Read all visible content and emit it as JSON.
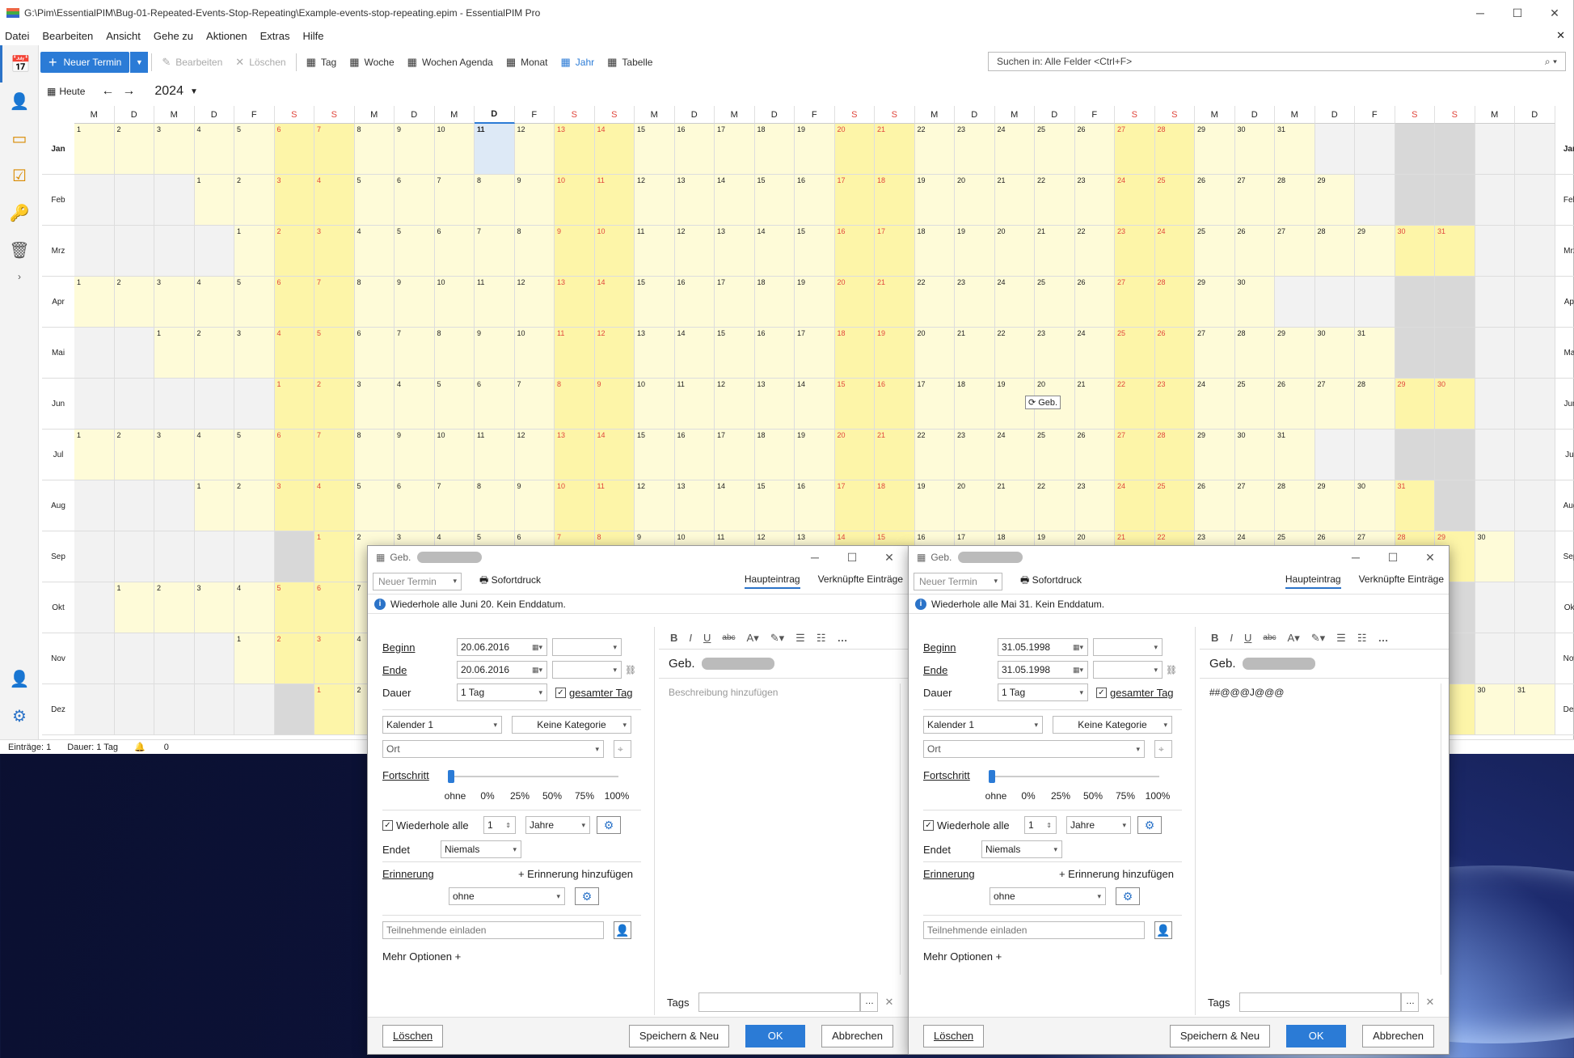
{
  "window": {
    "title": "G:\\Pim\\EssentialPIM\\Bug-01-Repeated-Events-Stop-Repeating\\Example-events-stop-repeating.epim - EssentialPIM Pro"
  },
  "menu": [
    "Datei",
    "Bearbeiten",
    "Ansicht",
    "Gehe zu",
    "Aktionen",
    "Extras",
    "Hilfe"
  ],
  "toolbar": {
    "new_appointment": "Neuer Termin",
    "edit": "Bearbeiten",
    "delete": "Löschen",
    "views": [
      "Tag",
      "Woche",
      "Wochen Agenda",
      "Monat",
      "Jahr",
      "Tabelle"
    ],
    "active_view": "Jahr",
    "search_placeholder": "Suchen in: Alle Felder  <Ctrl+F>"
  },
  "nav": {
    "today": "Heute",
    "year": "2024"
  },
  "calendar": {
    "weekday_header": [
      "M",
      "D",
      "M",
      "D",
      "F",
      "S",
      "S",
      "M",
      "D",
      "M",
      "D",
      "F",
      "S",
      "S",
      "M",
      "D",
      "M",
      "D",
      "F",
      "S",
      "S",
      "M",
      "D",
      "M",
      "D",
      "F",
      "S",
      "S",
      "M",
      "D",
      "M",
      "D",
      "F",
      "S",
      "S",
      "M",
      "D"
    ],
    "months": [
      "Jan",
      "Feb",
      "Mrz",
      "Apr",
      "Mai",
      "Jun",
      "Jul",
      "Aug",
      "Sep",
      "Okt",
      "Nov",
      "Dez"
    ],
    "month_offsets": [
      0,
      3,
      4,
      0,
      2,
      5,
      0,
      3,
      6,
      1,
      4,
      6
    ],
    "month_lengths": [
      31,
      29,
      31,
      30,
      31,
      30,
      31,
      31,
      30,
      31,
      30,
      31
    ],
    "today_column": 10,
    "event": {
      "label": "Geb.",
      "icon": "repeat-icon",
      "date": "2024-06-20"
    }
  },
  "statusbar": {
    "entries": "Einträge: 1",
    "duration": "Dauer: 1 Tag",
    "reminders": "0"
  },
  "dialogs": [
    {
      "title": "Geb.",
      "type": "Neuer Termin",
      "print": "Sofortdruck",
      "tabs": [
        "Haupteintrag",
        "Verknüpfte Einträge"
      ],
      "info": "Wiederhole alle Juni 20. Kein Enddatum.",
      "labels": {
        "begin": "Beginn",
        "end": "Ende",
        "duration": "Dauer",
        "allday": "gesamter Tag",
        "progress": "Fortschritt",
        "repeat": "Wiederhole alle",
        "ends": "Endet",
        "reminder": "Erinnerung",
        "add_reminder": "+ Erinnerung hinzufügen",
        "invite": "Teilnehmende einladen",
        "more": "Mehr Optionen +",
        "tags": "Tags"
      },
      "begin_date": "20.06.2016",
      "end_date": "20.06.2016",
      "duration": "1 Tag",
      "calendar": "Kalender 1",
      "category": "Keine Kategorie",
      "location": "Ort",
      "progress_ticks": [
        "ohne",
        "0%",
        "25%",
        "50%",
        "75%",
        "100%"
      ],
      "repeat_interval": "1",
      "repeat_unit": "Jahre",
      "ends_value": "Niemals",
      "reminder_value": "ohne",
      "subject": "Geb.",
      "description": "Beschreibung hinzufügen",
      "description_is_placeholder": true,
      "buttons": {
        "delete": "Löschen",
        "save_new": "Speichern & Neu",
        "ok": "OK",
        "cancel": "Abbrechen"
      }
    },
    {
      "title": "Geb.",
      "type": "Neuer Termin",
      "print": "Sofortdruck",
      "tabs": [
        "Haupteintrag",
        "Verknüpfte Einträge"
      ],
      "info": "Wiederhole alle Mai 31. Kein Enddatum.",
      "labels": {
        "begin": "Beginn",
        "end": "Ende",
        "duration": "Dauer",
        "allday": "gesamter Tag",
        "progress": "Fortschritt",
        "repeat": "Wiederhole alle",
        "ends": "Endet",
        "reminder": "Erinnerung",
        "add_reminder": "+ Erinnerung hinzufügen",
        "invite": "Teilnehmende einladen",
        "more": "Mehr Optionen +",
        "tags": "Tags"
      },
      "begin_date": "31.05.1998",
      "end_date": "31.05.1998",
      "duration": "1 Tag",
      "calendar": "Kalender 1",
      "category": "Keine Kategorie",
      "location": "Ort",
      "progress_ticks": [
        "ohne",
        "0%",
        "25%",
        "50%",
        "75%",
        "100%"
      ],
      "repeat_interval": "1",
      "repeat_unit": "Jahre",
      "ends_value": "Niemals",
      "reminder_value": "ohne",
      "subject": "Geb.",
      "description": "##@@@J@@@",
      "description_is_placeholder": false,
      "buttons": {
        "delete": "Löschen",
        "save_new": "Speichern & Neu",
        "ok": "OK",
        "cancel": "Abbrechen"
      }
    }
  ],
  "colors": {
    "accent": "#2b7bd6",
    "day_bg": "#fefbd8",
    "weekend_bg": "#fdf5a8",
    "weekend_text": "#e0463c"
  }
}
